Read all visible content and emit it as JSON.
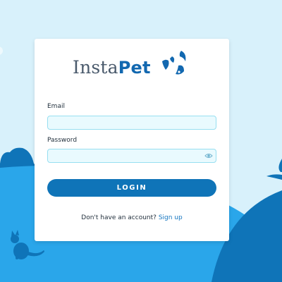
{
  "logo": {
    "part1": "Insta",
    "part2": "Pet"
  },
  "form": {
    "email_label": "Email",
    "email_value": "",
    "password_label": "Password",
    "password_value": "",
    "login_label": "LOGIN",
    "signup_prompt": "Don't have an account?",
    "signup_link": "Sign up"
  },
  "icons": {
    "logo_mark": "paw-mark-icon",
    "password_toggle": "eye-icon"
  },
  "colors": {
    "background": "#d8f1fb",
    "hill_light": "#2aa6ea",
    "hill_dark": "#0f74b8",
    "brand_blue": "#1268b0",
    "input_bg": "#e9fafe",
    "input_border": "#97dff1"
  }
}
